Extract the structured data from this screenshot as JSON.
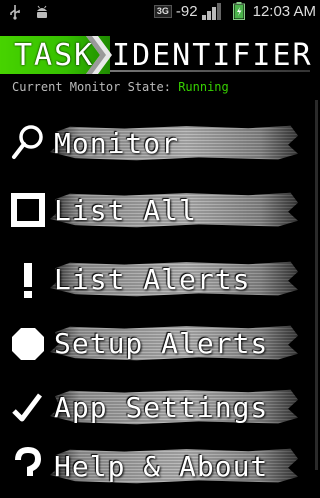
{
  "statusbar": {
    "network": "3G",
    "signal": "-92",
    "time": "12:03 AM"
  },
  "header": {
    "word1": "TASK",
    "word2": "IDENTIFIER",
    "accent_color": "#36c000"
  },
  "monitor": {
    "label": "Current Monitor State:",
    "value": "Running"
  },
  "menu": {
    "items": [
      {
        "label": "Monitor",
        "icon": "search-icon"
      },
      {
        "label": "List All",
        "icon": "square-icon"
      },
      {
        "label": "List Alerts",
        "icon": "exclamation-icon"
      },
      {
        "label": "Setup Alerts",
        "icon": "octagon-icon"
      },
      {
        "label": "App Settings",
        "icon": "checkmark-icon"
      },
      {
        "label": "Help & About",
        "icon": "question-icon"
      }
    ]
  }
}
